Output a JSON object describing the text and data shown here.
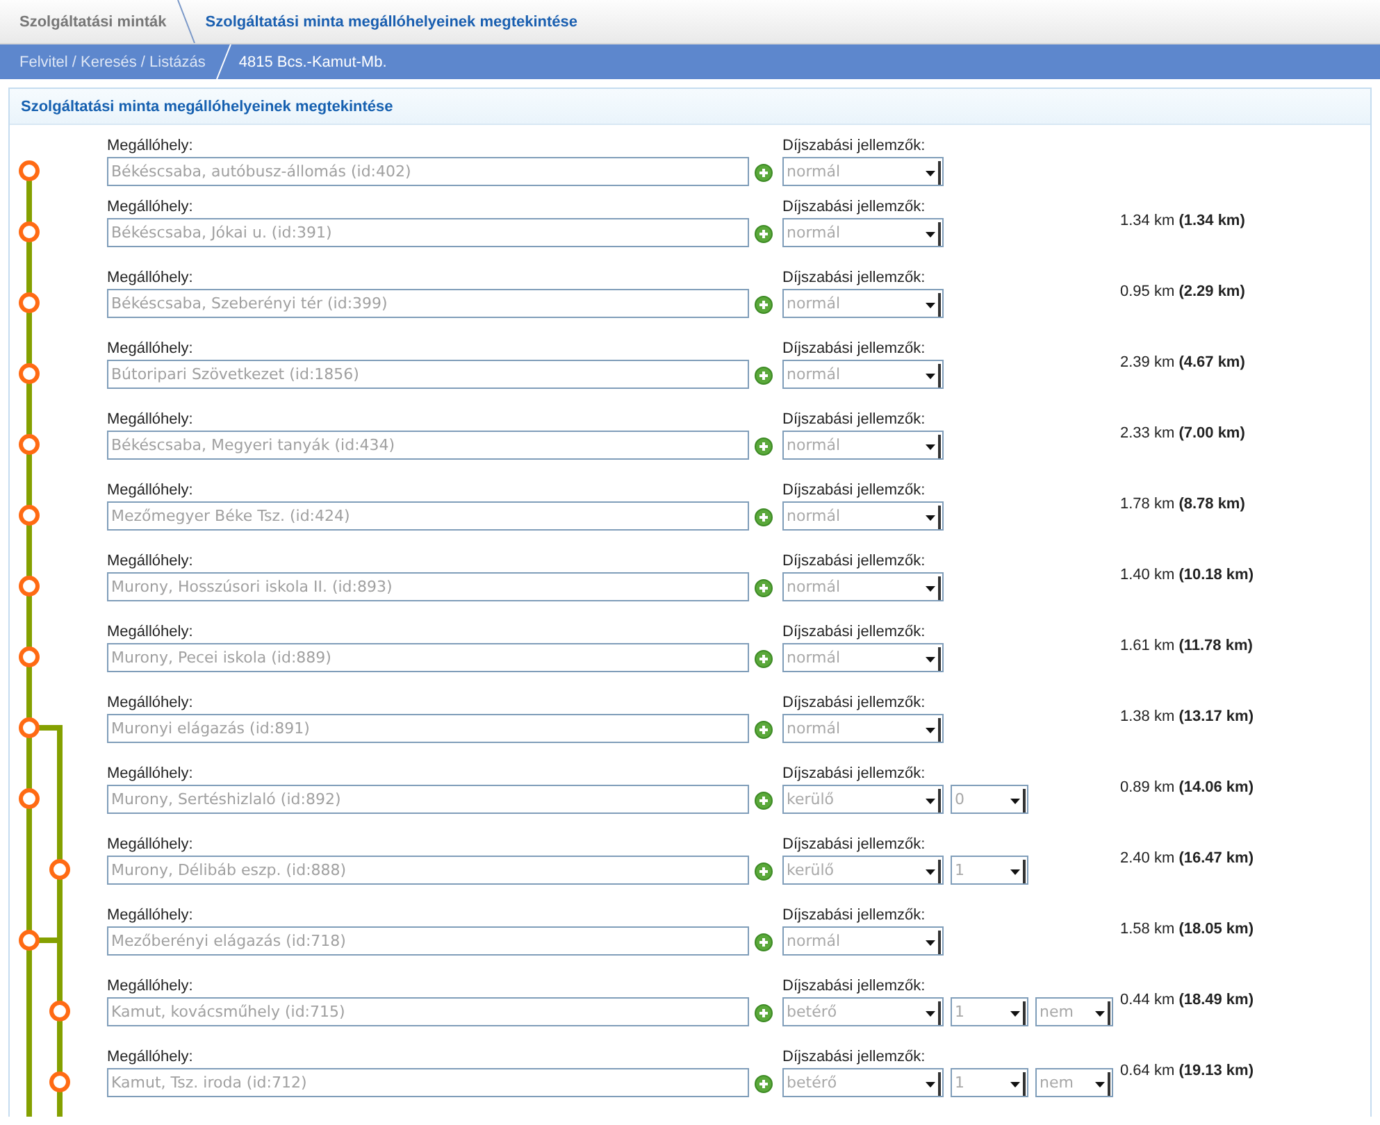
{
  "breadcrumb": {
    "parent": "Szolgáltatási minták",
    "current": "Szolgáltatási minta megállóhelyeinek megtekintése"
  },
  "subbar": {
    "parent": "Felvitel / Keresés / Listázás",
    "current": "4815 Bcs.-Kamut-Mb."
  },
  "panel": {
    "title": "Szolgáltatási minta megállóhelyeinek megtekintése",
    "stops": [
      {
        "label": "Megállóhely:",
        "fare_label": "Díjszabási jellemzők:",
        "name": "Békéscsaba, autóbusz-állomás (id:402)",
        "on_branch": false,
        "branch_link": false,
        "fares": [
          "normál"
        ]
      },
      {
        "label": "Megállóhely:",
        "fare_label": "Díjszabási jellemzők:",
        "name": "Békéscsaba, Jókai u. (id:391)",
        "on_branch": false,
        "branch_link": false,
        "fares": [
          "normál"
        ],
        "distance": "1.34 km **(1.34 km)**"
      },
      {
        "label": "Megállóhely:",
        "fare_label": "Díjszabási jellemzők:",
        "name": "Békéscsaba, Szeberényi tér (id:399)",
        "on_branch": false,
        "branch_link": false,
        "fares": [
          "normál"
        ],
        "distance": "0.95 km **(2.29 km)**"
      },
      {
        "label": "Megállóhely:",
        "fare_label": "Díjszabási jellemzők:",
        "name": "Bútoripari Szövetkezet (id:1856)",
        "on_branch": false,
        "branch_link": false,
        "fares": [
          "normál"
        ],
        "distance": "2.39 km **(4.67 km)**"
      },
      {
        "label": "Megállóhely:",
        "fare_label": "Díjszabási jellemzők:",
        "name": "Békéscsaba, Megyeri tanyák (id:434)",
        "on_branch": false,
        "branch_link": false,
        "fares": [
          "normál"
        ],
        "distance": "2.33 km **(7.00 km)**"
      },
      {
        "label": "Megállóhely:",
        "fare_label": "Díjszabási jellemzők:",
        "name": "Mezőmegyer Béke Tsz. (id:424)",
        "on_branch": false,
        "branch_link": false,
        "fares": [
          "normál"
        ],
        "distance": "1.78 km **(8.78 km)**"
      },
      {
        "label": "Megállóhely:",
        "fare_label": "Díjszabási jellemzők:",
        "name": "Murony, Hosszúsori iskola II. (id:893)",
        "on_branch": false,
        "branch_link": false,
        "fares": [
          "normál"
        ],
        "distance": "1.40 km **(10.18 km)**"
      },
      {
        "label": "Megállóhely:",
        "fare_label": "Díjszabási jellemzők:",
        "name": "Murony, Pecei iskola (id:889)",
        "on_branch": false,
        "branch_link": false,
        "fares": [
          "normál"
        ],
        "distance": "1.61 km **(11.78 km)**"
      },
      {
        "label": "Megállóhely:",
        "fare_label": "Díjszabási jellemzők:",
        "name": "Muronyi elágazás (id:891)",
        "on_branch": false,
        "branch_link": true,
        "fares": [
          "normál"
        ],
        "distance": "1.38 km **(13.17 km)**"
      },
      {
        "label": "Megállóhely:",
        "fare_label": "Díjszabási jellemzők:",
        "name": "Murony, Sertéshizlaló (id:892)",
        "on_branch": false,
        "branch_link": false,
        "fares": [
          "kerülő",
          "0"
        ],
        "distance": "0.89 km **(14.06 km)**"
      },
      {
        "label": "Megállóhely:",
        "fare_label": "Díjszabási jellemzők:",
        "name": "Murony, Délibáb eszp. (id:888)",
        "on_branch": true,
        "branch_link": false,
        "fares": [
          "kerülő",
          "1"
        ],
        "distance": "2.40 km **(16.47 km)**"
      },
      {
        "label": "Megállóhely:",
        "fare_label": "Díjszabási jellemzők:",
        "name": "Mezőberényi elágazás (id:718)",
        "on_branch": false,
        "branch_link": true,
        "fares": [
          "normál"
        ],
        "distance": "1.58 km **(18.05 km)**"
      },
      {
        "label": "Megállóhely:",
        "fare_label": "Díjszabási jellemzők:",
        "name": "Kamut, kovácsműhely (id:715)",
        "on_branch": true,
        "branch_link": false,
        "fares": [
          "betérő",
          "1",
          "nem"
        ],
        "distance": "0.44 km **(18.49 km)**"
      },
      {
        "label": "Megállóhely:",
        "fare_label": "Díjszabási jellemzők:",
        "name": "Kamut, Tsz. iroda (id:712)",
        "on_branch": true,
        "branch_link": false,
        "fares": [
          "betérő",
          "1",
          "nem"
        ],
        "distance": "0.64 km **(19.13 km)**"
      }
    ]
  }
}
